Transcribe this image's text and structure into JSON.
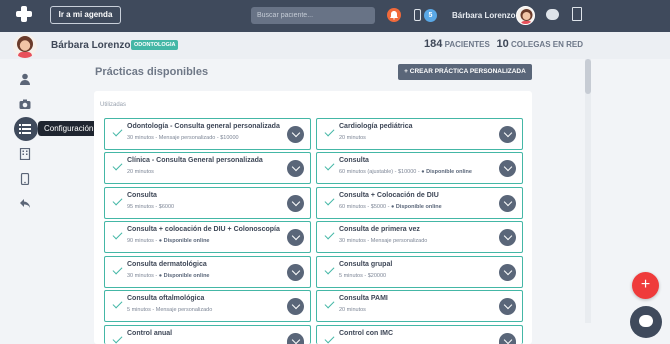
{
  "topbar": {
    "agenda_label": "Ir a mi agenda",
    "search_placeholder": "Buscar paciente...",
    "notif_count": "5",
    "user_name": "Bárbara Lorenzo"
  },
  "profile": {
    "name": "Bárbara Lorenzo",
    "specialty": "ODONTOLOGIA",
    "patients_count": "184",
    "patients_label": "PACIENTES",
    "colleagues_count": "10",
    "colleagues_label": "COLEGAS EN RED"
  },
  "sidebar": {
    "tooltip": "Configuración de prácticas",
    "icons": [
      "user-icon",
      "camera-icon",
      "list-icon",
      "building-icon",
      "phone-icon",
      "reply-icon"
    ]
  },
  "main": {
    "title": "Prácticas disponibles",
    "create_button": "CREAR PRÁCTICA PERSONALIZADA",
    "section_label": "Utilizadas",
    "practices": [
      {
        "title": "Odontología - Consulta general personalizada",
        "sub": "30 minutos - Mensaje personalizado - $10000",
        "online": ""
      },
      {
        "title": "Cardiología pediátrica",
        "sub": "20 minutos",
        "online": ""
      },
      {
        "title": "Clínica - Consulta General personalizada",
        "sub": "20 minutos",
        "online": ""
      },
      {
        "title": "Consulta",
        "sub": "60 minutos (ajustable) - $10000 - ",
        "online": "Disponible online"
      },
      {
        "title": "Consulta",
        "sub": "95 minutos - $6000",
        "online": ""
      },
      {
        "title": "Consulta + Colocación de DIU",
        "sub": "60 minutos - $5000 - ",
        "online": "Disponible online"
      },
      {
        "title": "Consulta + colocación de DIU + Colonoscopía",
        "sub": "90 minutos - ",
        "online": "Disponible online"
      },
      {
        "title": "Consulta de primera vez",
        "sub": "30 minutos - Mensaje personalizado",
        "online": ""
      },
      {
        "title": "Consulta dermatológica",
        "sub": "30 minutos - ",
        "online": "Disponible online"
      },
      {
        "title": "Consulta grupal",
        "sub": "5 minutos - $20000",
        "online": ""
      },
      {
        "title": "Consulta oftalmológica",
        "sub": "5 minutos - Mensaje personalizado",
        "online": ""
      },
      {
        "title": "Consulta PAMI",
        "sub": "20 minutos",
        "online": ""
      },
      {
        "title": "Control anual",
        "sub": "",
        "online": ""
      },
      {
        "title": "Control con IMC",
        "sub": "",
        "online": ""
      }
    ]
  },
  "colors": {
    "topbar": "#3f4a5c",
    "accent": "#44b7a6",
    "notification": "#f16a3b",
    "fab": "#ef3b3b"
  }
}
